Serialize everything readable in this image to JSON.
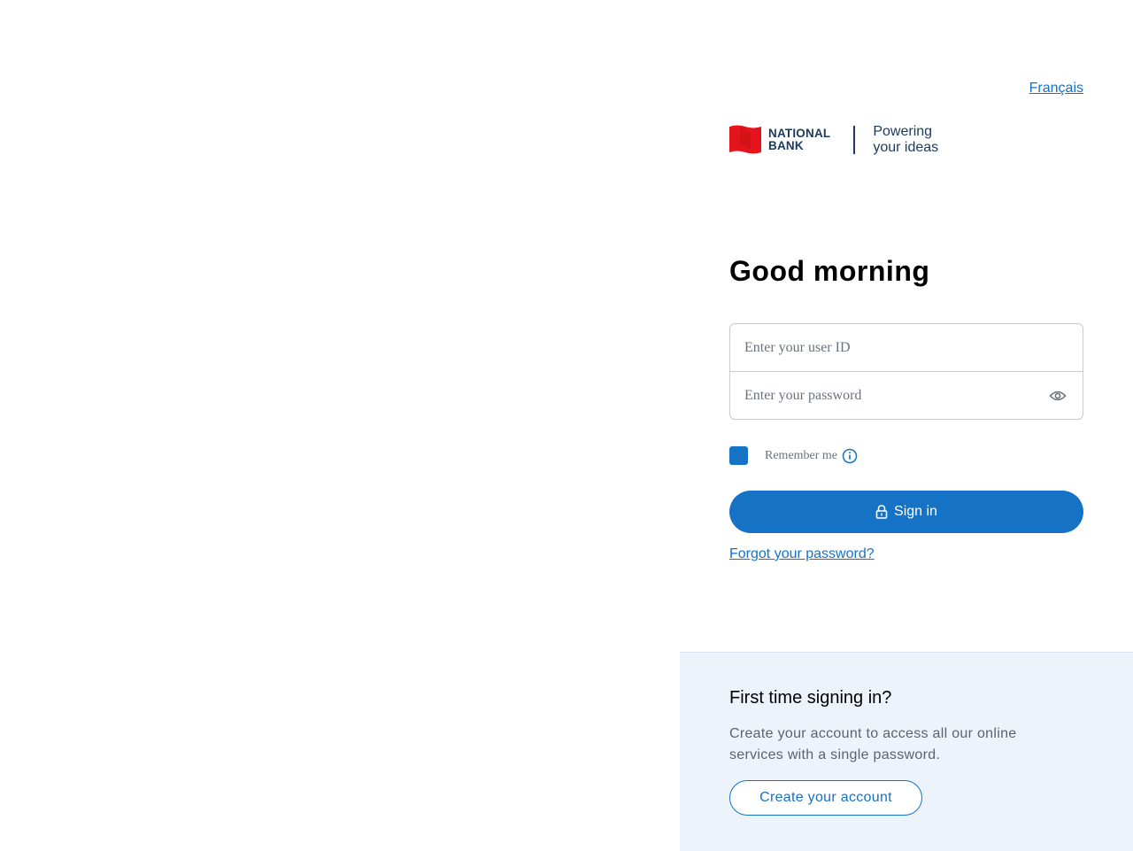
{
  "header": {
    "language_link": "Français"
  },
  "brand": {
    "logo_line1": "NATIONAL",
    "logo_line2": "BANK",
    "tagline_line1": "Powering",
    "tagline_line2": "your ideas",
    "logo_color": "#e3141b",
    "text_color": "#1b3a5c"
  },
  "login": {
    "greeting": "Good morning",
    "user_id_placeholder": "Enter your user ID",
    "password_placeholder": "Enter your password",
    "remember_label": "Remember me",
    "sign_in_label": "Sign in",
    "forgot_password_link": "Forgot your password?"
  },
  "signup": {
    "title": "First time signing in?",
    "description": "Create your account to access all our online services with a single password.",
    "button_label": "Create your account"
  },
  "icons": {
    "password_toggle": "eye-icon",
    "remember_info": "info-icon",
    "sign_in": "lock-icon",
    "brand_logo": "flag-icon"
  },
  "colors": {
    "accent": "#1572c5",
    "signup_background": "#edf3fa"
  }
}
